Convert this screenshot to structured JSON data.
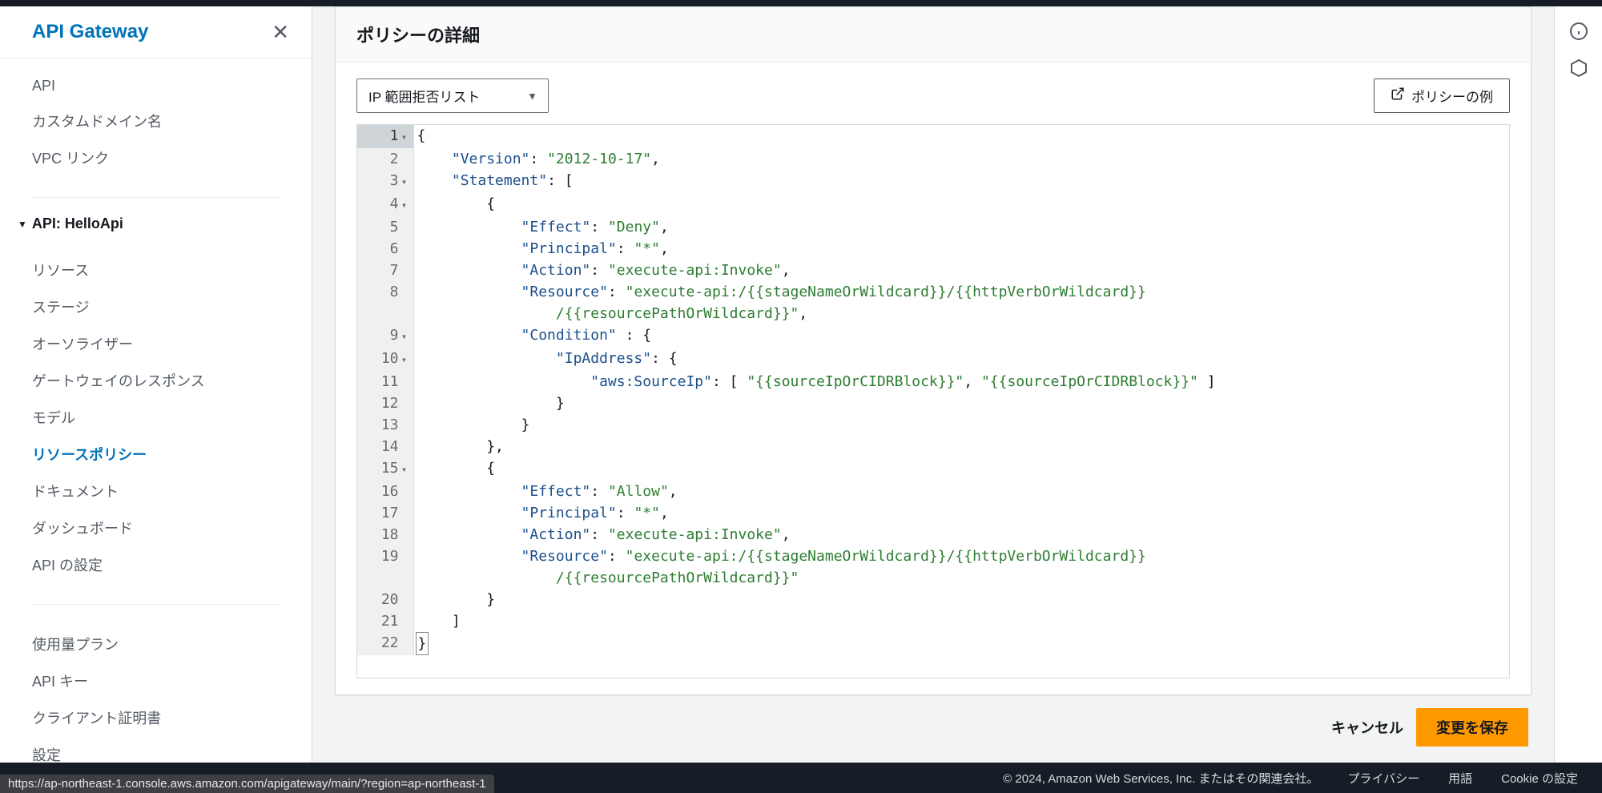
{
  "sidebar": {
    "title": "API Gateway",
    "top_items": [
      "API",
      "カスタムドメイン名",
      "VPC リンク"
    ],
    "api_heading": "API: HelloApi",
    "api_items": [
      "リソース",
      "ステージ",
      "オーソライザー",
      "ゲートウェイのレスポンス",
      "モデル",
      "リソースポリシー",
      "ドキュメント",
      "ダッシュボード",
      "API の設定"
    ],
    "active_api_item": "リソースポリシー",
    "bottom_items": [
      "使用量プラン",
      "API キー",
      "クライアント証明書",
      "設定"
    ]
  },
  "panel": {
    "title": "ポリシーの詳細",
    "select_label": "IP 範囲拒否リスト",
    "example_button": "ポリシーの例"
  },
  "editor_lines": [
    {
      "n": 1,
      "fold": true,
      "active": true,
      "tokens": [
        [
          "punc",
          "{"
        ]
      ]
    },
    {
      "n": 2,
      "fold": false,
      "tokens": [
        [
          "pad",
          "    "
        ],
        [
          "key",
          "\"Version\""
        ],
        [
          "colon",
          ": "
        ],
        [
          "str",
          "\"2012-10-17\""
        ],
        [
          "punc",
          ","
        ]
      ]
    },
    {
      "n": 3,
      "fold": true,
      "tokens": [
        [
          "pad",
          "    "
        ],
        [
          "key",
          "\"Statement\""
        ],
        [
          "colon",
          ": "
        ],
        [
          "punc",
          "["
        ]
      ]
    },
    {
      "n": 4,
      "fold": true,
      "tokens": [
        [
          "pad",
          "        "
        ],
        [
          "punc",
          "{"
        ]
      ]
    },
    {
      "n": 5,
      "fold": false,
      "tokens": [
        [
          "pad",
          "            "
        ],
        [
          "key",
          "\"Effect\""
        ],
        [
          "colon",
          ": "
        ],
        [
          "str",
          "\"Deny\""
        ],
        [
          "punc",
          ","
        ]
      ]
    },
    {
      "n": 6,
      "fold": false,
      "tokens": [
        [
          "pad",
          "            "
        ],
        [
          "key",
          "\"Principal\""
        ],
        [
          "colon",
          ": "
        ],
        [
          "str",
          "\"*\""
        ],
        [
          "punc",
          ","
        ]
      ]
    },
    {
      "n": 7,
      "fold": false,
      "tokens": [
        [
          "pad",
          "            "
        ],
        [
          "key",
          "\"Action\""
        ],
        [
          "colon",
          ": "
        ],
        [
          "str",
          "\"execute-api:Invoke\""
        ],
        [
          "punc",
          ","
        ]
      ]
    },
    {
      "n": 8,
      "fold": false,
      "tokens": [
        [
          "pad",
          "            "
        ],
        [
          "key",
          "\"Resource\""
        ],
        [
          "colon",
          ": "
        ],
        [
          "str",
          "\"execute-api:/{{stageNameOrWildcard}}/{{httpVerbOrWildcard}}"
        ]
      ]
    },
    {
      "n": "",
      "fold": false,
      "cont": true,
      "tokens": [
        [
          "pad",
          "                "
        ],
        [
          "str",
          "/{{resourcePathOrWildcard}}\""
        ],
        [
          "punc",
          ","
        ]
      ]
    },
    {
      "n": 9,
      "fold": true,
      "tokens": [
        [
          "pad",
          "            "
        ],
        [
          "key",
          "\"Condition\""
        ],
        [
          "colon",
          " : "
        ],
        [
          "punc",
          "{"
        ]
      ]
    },
    {
      "n": 10,
      "fold": true,
      "tokens": [
        [
          "pad",
          "                "
        ],
        [
          "key",
          "\"IpAddress\""
        ],
        [
          "colon",
          ": "
        ],
        [
          "punc",
          "{"
        ]
      ]
    },
    {
      "n": 11,
      "fold": false,
      "tokens": [
        [
          "pad",
          "                    "
        ],
        [
          "key",
          "\"aws:SourceIp\""
        ],
        [
          "colon",
          ": "
        ],
        [
          "punc",
          "[ "
        ],
        [
          "str",
          "\"{{sourceIpOrCIDRBlock}}\""
        ],
        [
          "punc",
          ", "
        ],
        [
          "str",
          "\"{{sourceIpOrCIDRBlock}}\""
        ],
        [
          "punc",
          " ]"
        ]
      ]
    },
    {
      "n": 12,
      "fold": false,
      "tokens": [
        [
          "pad",
          "                "
        ],
        [
          "punc",
          "}"
        ]
      ]
    },
    {
      "n": 13,
      "fold": false,
      "tokens": [
        [
          "pad",
          "            "
        ],
        [
          "punc",
          "}"
        ]
      ]
    },
    {
      "n": 14,
      "fold": false,
      "tokens": [
        [
          "pad",
          "        "
        ],
        [
          "punc",
          "},"
        ]
      ]
    },
    {
      "n": 15,
      "fold": true,
      "tokens": [
        [
          "pad",
          "        "
        ],
        [
          "punc",
          "{"
        ]
      ]
    },
    {
      "n": 16,
      "fold": false,
      "tokens": [
        [
          "pad",
          "            "
        ],
        [
          "key",
          "\"Effect\""
        ],
        [
          "colon",
          ": "
        ],
        [
          "str",
          "\"Allow\""
        ],
        [
          "punc",
          ","
        ]
      ]
    },
    {
      "n": 17,
      "fold": false,
      "tokens": [
        [
          "pad",
          "            "
        ],
        [
          "key",
          "\"Principal\""
        ],
        [
          "colon",
          ": "
        ],
        [
          "str",
          "\"*\""
        ],
        [
          "punc",
          ","
        ]
      ]
    },
    {
      "n": 18,
      "fold": false,
      "tokens": [
        [
          "pad",
          "            "
        ],
        [
          "key",
          "\"Action\""
        ],
        [
          "colon",
          ": "
        ],
        [
          "str",
          "\"execute-api:Invoke\""
        ],
        [
          "punc",
          ","
        ]
      ]
    },
    {
      "n": 19,
      "fold": false,
      "tokens": [
        [
          "pad",
          "            "
        ],
        [
          "key",
          "\"Resource\""
        ],
        [
          "colon",
          ": "
        ],
        [
          "str",
          "\"execute-api:/{{stageNameOrWildcard}}/{{httpVerbOrWildcard}}"
        ]
      ]
    },
    {
      "n": "",
      "fold": false,
      "cont": true,
      "tokens": [
        [
          "pad",
          "                "
        ],
        [
          "str",
          "/{{resourcePathOrWildcard}}\""
        ]
      ]
    },
    {
      "n": 20,
      "fold": false,
      "tokens": [
        [
          "pad",
          "        "
        ],
        [
          "punc",
          "}"
        ]
      ]
    },
    {
      "n": 21,
      "fold": false,
      "tokens": [
        [
          "pad",
          "    "
        ],
        [
          "punc",
          "]"
        ]
      ]
    },
    {
      "n": 22,
      "fold": false,
      "tokens": [
        [
          "cursorbox",
          "}"
        ]
      ]
    }
  ],
  "actions": {
    "cancel": "キャンセル",
    "save": "変更を保存"
  },
  "footer": {
    "copyright": "© 2024, Amazon Web Services, Inc. またはその関連会社。",
    "privacy": "プライバシー",
    "terms": "用語",
    "cookies": "Cookie の設定"
  },
  "status_url": "https://ap-northeast-1.console.aws.amazon.com/apigateway/main/?region=ap-northeast-1"
}
